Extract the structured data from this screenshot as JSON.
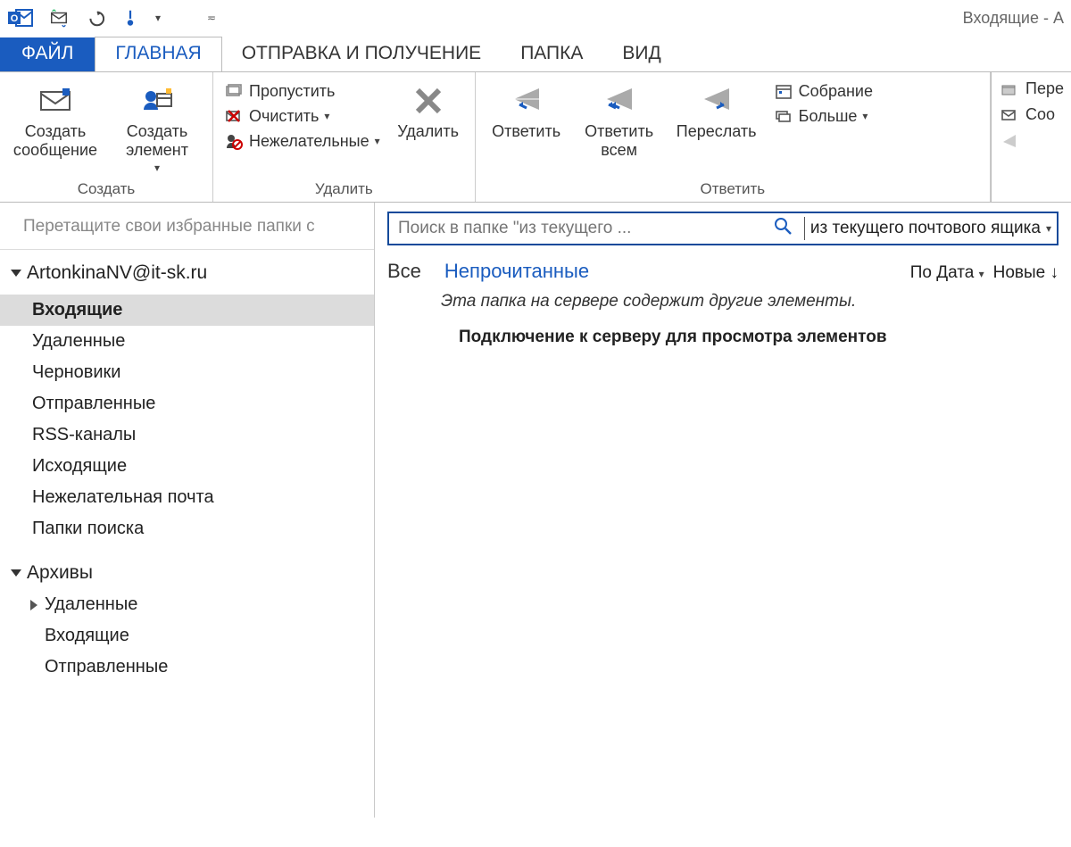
{
  "window": {
    "title": "Входящие - A"
  },
  "tabs": {
    "file": "ФАЙЛ",
    "home": "ГЛАВНАЯ",
    "sendreceive": "ОТПРАВКА И ПОЛУЧЕНИЕ",
    "folder": "ПАПКА",
    "view": "ВИД"
  },
  "ribbon": {
    "create": {
      "new_mail": "Создать сообщение",
      "new_item": "Создать элемент",
      "label": "Создать"
    },
    "delete": {
      "ignore": "Пропустить",
      "cleanup": "Очистить",
      "junk": "Нежелательные",
      "delete": "Удалить",
      "label": "Удалить"
    },
    "respond": {
      "reply": "Ответить",
      "reply_all": "Ответить всем",
      "forward": "Переслать",
      "meeting": "Собрание",
      "more": "Больше",
      "label": "Ответить"
    },
    "right": {
      "move": "Пере",
      "create_msg": "Соо"
    }
  },
  "folders": {
    "fav_hint": "Перетащите свои избранные папки с",
    "account": "ArtonkinaNV@it-sk.ru",
    "items": [
      {
        "label": "Входящие",
        "selected": true
      },
      {
        "label": "Удаленные"
      },
      {
        "label": "Черновики"
      },
      {
        "label": "Отправленные"
      },
      {
        "label": "RSS-каналы"
      },
      {
        "label": "Исходящие"
      },
      {
        "label": "Нежелательная почта"
      },
      {
        "label": "Папки поиска"
      }
    ],
    "archives": {
      "label": "Архивы",
      "items": [
        {
          "label": "Удаленные",
          "expandable": true
        },
        {
          "label": "Входящие"
        },
        {
          "label": "Отправленные"
        }
      ]
    }
  },
  "search": {
    "placeholder": "Поиск в папке \"из текущего ...",
    "scope": "из текущего почтового ящика"
  },
  "filters": {
    "all": "Все",
    "unread": "Непрочитанные",
    "sort_by": "По Дата",
    "sort_dir": "Новые"
  },
  "messages": {
    "server_hint": "Эта папка на сервере содержит другие элементы.",
    "connect_hint": "Подключение к серверу для просмотра элементов"
  }
}
